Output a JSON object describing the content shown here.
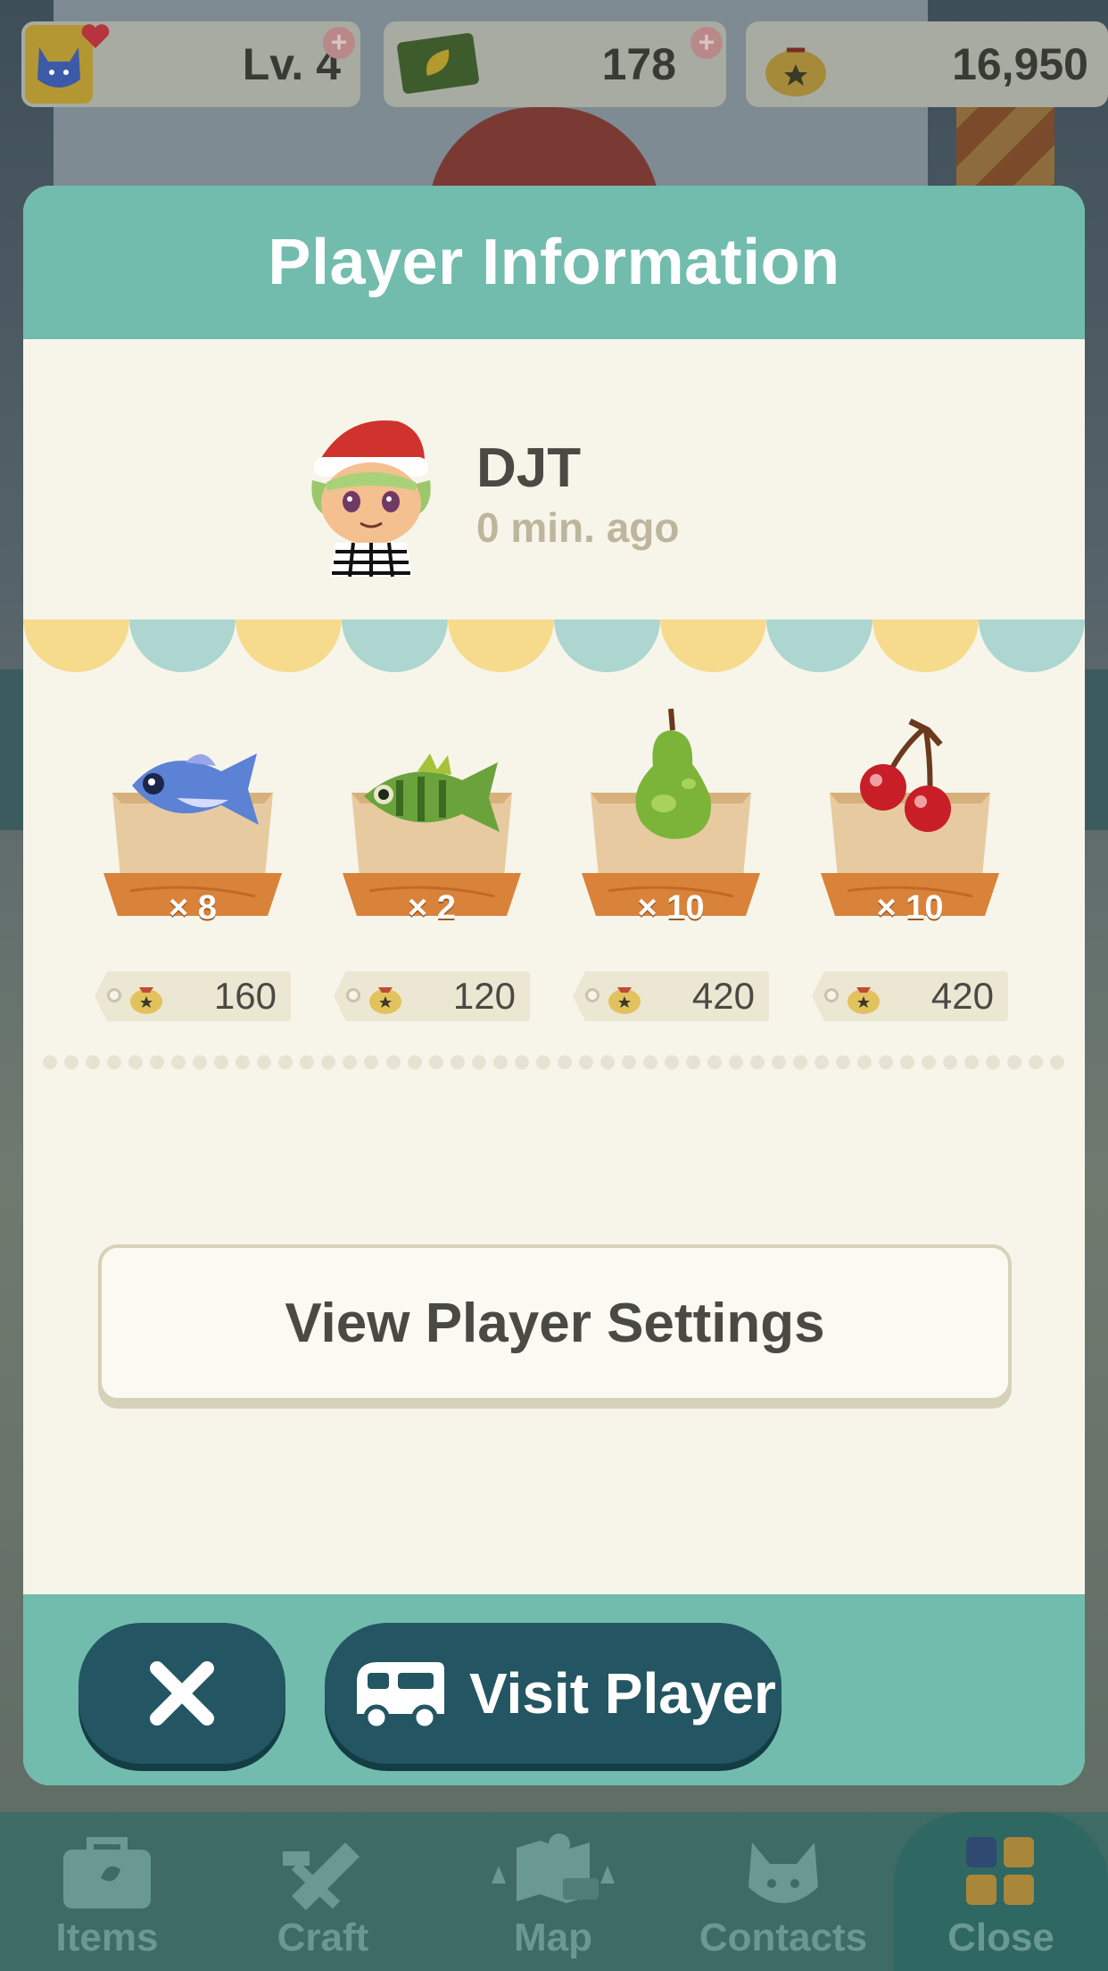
{
  "status_bar": {
    "level": "Lv. 4",
    "tickets": "178",
    "bells": "16,950",
    "icons": [
      "player-cat-icon",
      "heart-icon",
      "leaf-ticket-icon",
      "plus-icon",
      "bell-bag-icon"
    ]
  },
  "dialog": {
    "title": "Player Information",
    "player": {
      "name": "DJT",
      "last_seen": "0 min. ago"
    },
    "shop_items": [
      {
        "item": "fish",
        "icon": "blue-fish-icon",
        "quantity": "× 8",
        "price": "160"
      },
      {
        "item": "fish",
        "icon": "green-fish-icon",
        "quantity": "× 2",
        "price": "120"
      },
      {
        "item": "pear",
        "icon": "pear-icon",
        "quantity": "× 10",
        "price": "420"
      },
      {
        "item": "cherry",
        "icon": "cherry-icon",
        "quantity": "× 10",
        "price": "420"
      }
    ],
    "settings_button": "View Player Settings",
    "close_icon": "close-x-icon",
    "visit_button": "Visit Player",
    "visit_icon": "camper-van-icon"
  },
  "bottom_nav": {
    "items": [
      {
        "label": "Items",
        "icon": "bag-icon"
      },
      {
        "label": "Craft",
        "icon": "saw-hammer-icon"
      },
      {
        "label": "Map",
        "icon": "map-icon"
      },
      {
        "label": "Contacts",
        "icon": "cat-face-icon"
      },
      {
        "label": "Close",
        "icon": "grid-icon"
      }
    ]
  },
  "colors": {
    "header_teal": "#72bcad",
    "button_dark_teal": "#235662",
    "panel_cream": "#f7f5ea",
    "awning_yellow": "#f7db8d",
    "awning_blue": "#acd6cf"
  }
}
